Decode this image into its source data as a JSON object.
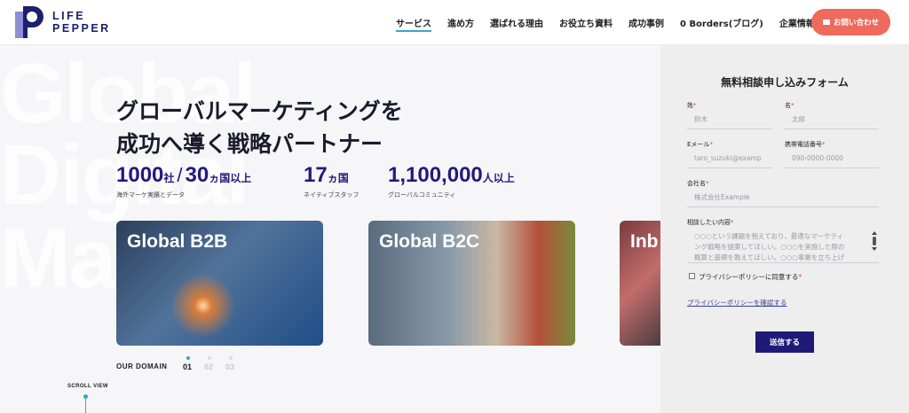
{
  "header": {
    "logo_line1": "LIFE",
    "logo_line2": "PEPPER",
    "nav": [
      {
        "label": "サービス"
      },
      {
        "label": "進め方"
      },
      {
        "label": "選ばれる理由"
      },
      {
        "label": "お役立ち資料"
      },
      {
        "label": "成功事例"
      },
      {
        "label": "0 Borders(ブログ)"
      },
      {
        "label": "企業情報"
      }
    ],
    "contact_label": "お問い合わせ"
  },
  "hero": {
    "bg_words": [
      "Global",
      "Digital",
      "Mar"
    ],
    "headline_line1": "グローバルマーケティングを",
    "headline_line2": "成功へ導く戦略パートナー",
    "stats": [
      {
        "num_a": "1000",
        "unit_a": "社",
        "sep": "/",
        "num_b": "30",
        "unit_b": "ヵ国以上",
        "caption": "海外マーケ実績とデータ"
      },
      {
        "num_a": "17",
        "unit_a": "ヵ国",
        "caption": "ネイティブスタッフ"
      },
      {
        "num_a": "1,100,000",
        "unit_a": "人以上",
        "caption": "グローバルコミュニティ"
      }
    ],
    "cards": [
      {
        "title": "Global B2B"
      },
      {
        "title": "Global B2C"
      },
      {
        "title": "Inb"
      }
    ],
    "domain_label": "OUR DOMAIN",
    "domain_indices": [
      "01",
      "02",
      "03"
    ],
    "scroll_label": "SCROLL VIEW"
  },
  "form": {
    "title": "無料相談申し込みフォーム",
    "last_name_label": "姓",
    "last_name_placeholder": "鈴木",
    "first_name_label": "名",
    "first_name_placeholder": "太郎",
    "email_label": "Eメール",
    "email_placeholder": "taro_suzuki@examp",
    "phone_label": "携帯電話番号",
    "phone_placeholder": "090-0000-0000",
    "company_label": "会社名",
    "company_placeholder": "株式会社Example",
    "message_label": "相談したい内容",
    "message_placeholder_line1": "○○○という課題を抱えており、最適なマーケティ",
    "message_placeholder_line2": "ング戦略を提案してほしい。○○○を実施した際の",
    "message_placeholder_line3": "概算と基礎を教えてほしい。○○○事業を立ち上げ",
    "required_mark": "*",
    "privacy_checkbox_label": "プライバシーポリシーに同意する",
    "privacy_link": "プライバシーポリシーを確認する",
    "submit_label": "送信する"
  },
  "colors": {
    "brand_navy": "#221a7c",
    "accent_coral": "#ee6a5c",
    "accent_teal": "#3aa6c9"
  }
}
